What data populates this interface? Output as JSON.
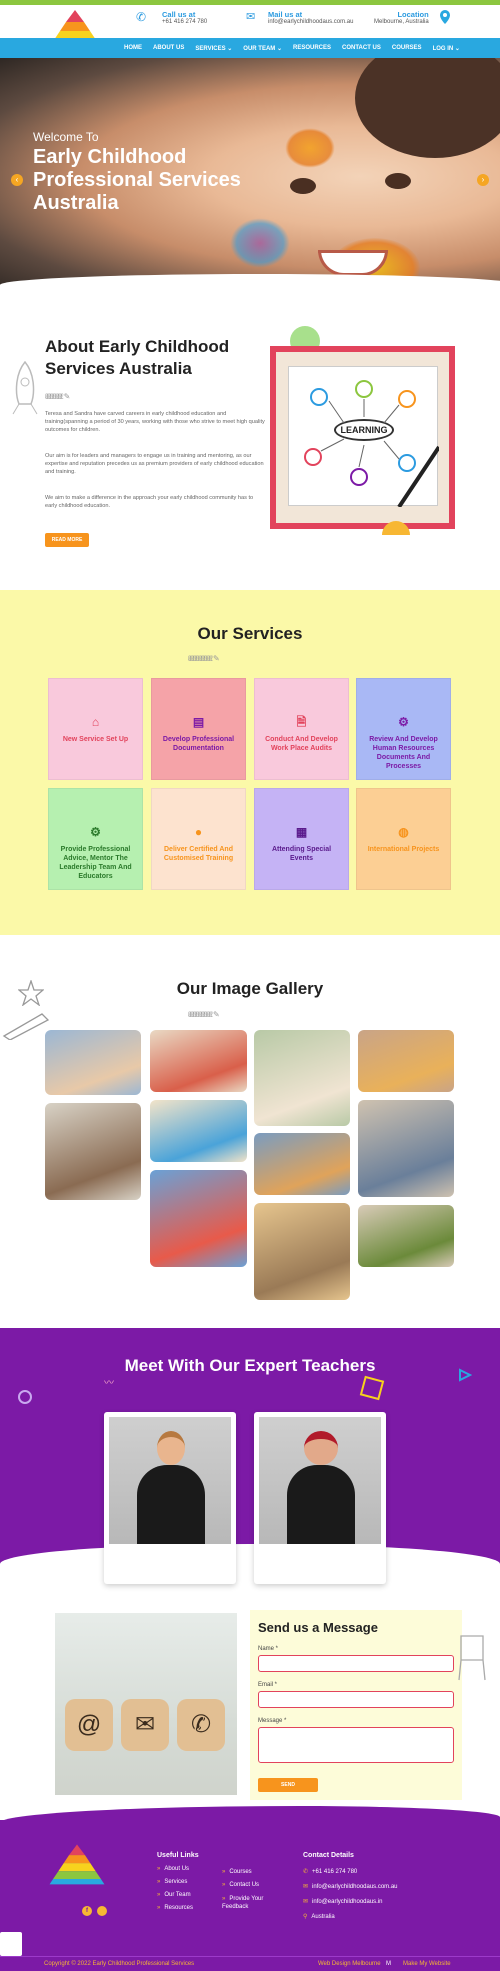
{
  "header": {
    "call": {
      "title": "Call us at",
      "value": "+61 416 274 780"
    },
    "mail": {
      "title": "Mail us at",
      "value": "info@earlychildhoodaus.com.au"
    },
    "location": {
      "title": "Location",
      "value": "Melbourne, Australia"
    }
  },
  "nav": [
    "HOME",
    "ABOUT US",
    "SERVICES ⌄",
    "OUR TEAM ⌄",
    "RESOURCES",
    "CONTACT US",
    "COURSES",
    "LOG IN ⌄"
  ],
  "hero": {
    "welcome": "Welcome To",
    "title": "Early Childhood Professional Services Australia",
    "prev": "‹",
    "next": "›"
  },
  "about": {
    "title": "About Early Childhood Services Australia",
    "squiggle": "ℓℓℓℓℓℓℓℓℓℓℓ ✎",
    "p1": "Teresa and Sandra have carved careers in early childhood education and training(spanning a period of 30 years, working with those who strive to meet high quality outcomes for children.",
    "p2": "Our aim is for leaders and managers to engage us in training and mentoring, as our expertise and reputation precedes us as premium providers of early childhood education and training.",
    "p3": "We aim to make a difference in the approach your early childhood community has to early childhood education.",
    "button": "READ MORE",
    "learning_word": "LEARNING"
  },
  "services": {
    "title": "Our Services",
    "squiggle": "ℓℓℓℓℓℓℓℓℓℓℓℓℓℓℓ ✎",
    "items": [
      {
        "label": "New Service Set Up",
        "icon": "home-icon",
        "glyph": "⌂",
        "bg": "#f9c9dc",
        "fg": "#e2435c"
      },
      {
        "label": "Develop Professional Documentation",
        "icon": "document-icon",
        "glyph": "▤",
        "bg": "#f5a3a8",
        "fg": "#7c1aa6"
      },
      {
        "label": "Conduct And Develop Work Place Audits",
        "icon": "file-icon",
        "glyph": "🗎",
        "bg": "#f9c9dc",
        "fg": "#e2435c"
      },
      {
        "label": "Review And Develop Human Resources Documents And Processes",
        "icon": "cogs-icon",
        "glyph": "⚙",
        "bg": "#a9b8f5",
        "fg": "#7c1aa6"
      },
      {
        "label": "Provide Professional Advice, Mentor The Leadership Team And Educators",
        "icon": "user-cog-icon",
        "glyph": "⚙",
        "bg": "#b6f0b0",
        "fg": "#2b7a2b"
      },
      {
        "label": "Deliver Certified And Customised Training",
        "icon": "user-icon",
        "glyph": "●",
        "bg": "#fde3cf",
        "fg": "#f7941d"
      },
      {
        "label": "Attending Special Events",
        "icon": "calendar-icon",
        "glyph": "▦",
        "bg": "#c5b3f5",
        "fg": "#5a1a8c"
      },
      {
        "label": "International Projects",
        "icon": "globe-icon",
        "glyph": "◍",
        "bg": "#fccf94",
        "fg": "#f7941d"
      }
    ]
  },
  "gallery": {
    "title": "Our Image Gallery",
    "squiggle": "ℓℓℓℓℓℓℓℓℓℓℓℓℓℓℓ ✎"
  },
  "teachers": {
    "title": "Meet With Our Expert Teachers"
  },
  "contact": {
    "title": "Send us a Message",
    "name_label": "Name *",
    "email_label": "Email *",
    "message_label": "Message *",
    "submit": "SEND"
  },
  "footer": {
    "useful_title": "Useful Links",
    "useful_col1": [
      "About Us",
      "Services",
      "Our Team",
      "Resources"
    ],
    "useful_col2": [
      "Courses",
      "Contact Us",
      "Provide Your Feedback"
    ],
    "contact_title": "Contact Details",
    "contact": [
      "+61 416 274 780",
      "info@earlychildhoodaus.com.au",
      "info@earlychildhoodaus.in",
      "Australia"
    ],
    "copyright": "Copyright © 2022 Early Childhood Professional Services",
    "credit_left": "Web Design Melbourne",
    "credit_right": "Make My Website"
  }
}
